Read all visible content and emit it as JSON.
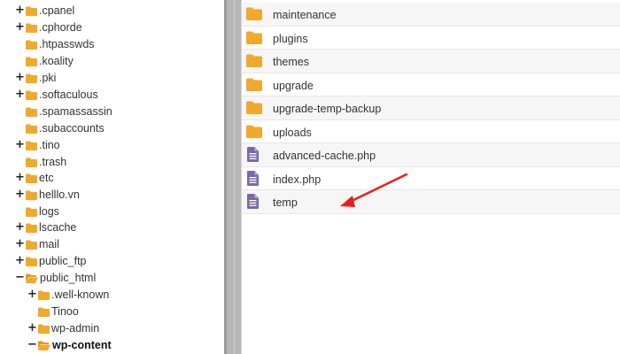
{
  "tree": {
    "items": [
      {
        "label": ".cpanel",
        "toggle": "+",
        "icon": "folder-icon"
      },
      {
        "label": ".cphorde",
        "toggle": "+",
        "icon": "folder-icon"
      },
      {
        "label": ".htpasswds",
        "toggle": "",
        "icon": "folder-icon"
      },
      {
        "label": ".koality",
        "toggle": "",
        "icon": "folder-icon"
      },
      {
        "label": ".pki",
        "toggle": "+",
        "icon": "folder-icon"
      },
      {
        "label": ".softaculous",
        "toggle": "+",
        "icon": "folder-icon"
      },
      {
        "label": ".spamassassin",
        "toggle": "",
        "icon": "folder-icon"
      },
      {
        "label": ".subaccounts",
        "toggle": "",
        "icon": "folder-icon"
      },
      {
        "label": ".tino",
        "toggle": "+",
        "icon": "folder-icon"
      },
      {
        "label": ".trash",
        "toggle": "",
        "icon": "folder-icon"
      },
      {
        "label": "etc",
        "toggle": "+",
        "icon": "folder-icon"
      },
      {
        "label": "helllo.vn",
        "toggle": "+",
        "icon": "folder-icon"
      },
      {
        "label": "logs",
        "toggle": "",
        "icon": "folder-icon"
      },
      {
        "label": "lscache",
        "toggle": "+",
        "icon": "folder-icon"
      },
      {
        "label": "mail",
        "toggle": "+",
        "icon": "folder-icon"
      },
      {
        "label": "public_ftp",
        "toggle": "+",
        "icon": "folder-icon"
      },
      {
        "label": "public_html",
        "toggle": "−",
        "icon": "folder-open-icon"
      },
      {
        "label": ".well-known",
        "toggle": "+",
        "icon": "folder-icon"
      },
      {
        "label": "Tinoo",
        "toggle": "",
        "icon": "folder-icon"
      },
      {
        "label": "wp-admin",
        "toggle": "+",
        "icon": "folder-icon"
      },
      {
        "label": "wp-content",
        "toggle": "−",
        "icon": "folder-open-icon",
        "active": true
      }
    ]
  },
  "files": [
    {
      "name": "maintenance",
      "type": "folder",
      "icon": "folder-icon"
    },
    {
      "name": "plugins",
      "type": "folder",
      "icon": "folder-icon"
    },
    {
      "name": "themes",
      "type": "folder",
      "icon": "folder-icon"
    },
    {
      "name": "upgrade",
      "type": "folder",
      "icon": "folder-icon"
    },
    {
      "name": "upgrade-temp-backup",
      "type": "folder",
      "icon": "folder-icon"
    },
    {
      "name": "uploads",
      "type": "folder",
      "icon": "folder-icon"
    },
    {
      "name": "advanced-cache.php",
      "type": "file",
      "icon": "file-icon"
    },
    {
      "name": "index.php",
      "type": "file",
      "icon": "file-icon"
    },
    {
      "name": "temp",
      "type": "file",
      "icon": "file-icon"
    }
  ],
  "annotation": {
    "icon": "red-arrow-icon",
    "color": "#e8201a"
  },
  "colors": {
    "folder": "#f0a92c",
    "file": "#7b68a8"
  }
}
